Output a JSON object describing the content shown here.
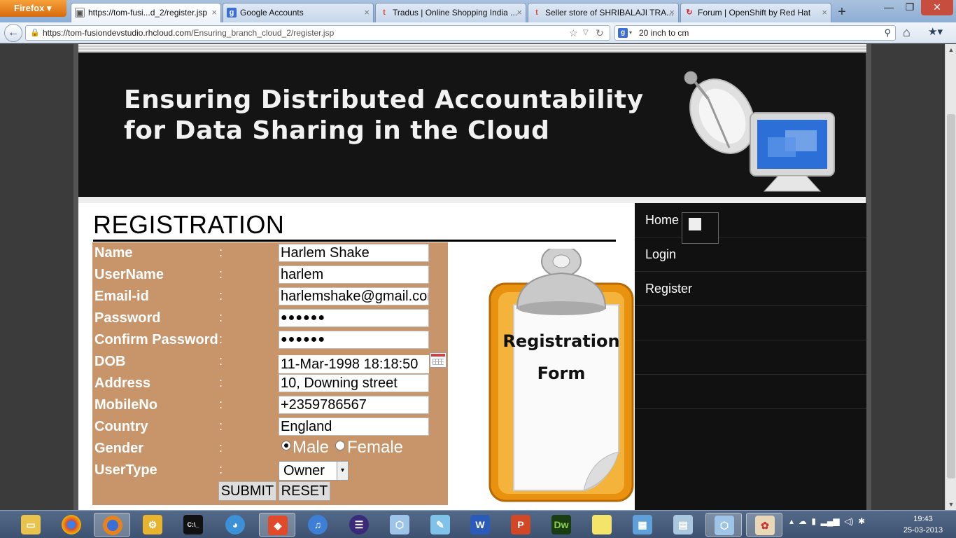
{
  "browser": {
    "menu_button": "Firefox",
    "tabs": [
      {
        "label": "https://tom-fusi...d_2/register.jsp",
        "favicon": "page"
      },
      {
        "label": "Google Accounts",
        "favicon": "g"
      },
      {
        "label": "Tradus | Online Shopping India ...",
        "favicon": "t"
      },
      {
        "label": "Seller store of SHRIBALAJI TRA...",
        "favicon": "t"
      },
      {
        "label": "Forum | OpenShift by Red Hat",
        "favicon": "openshift"
      }
    ],
    "url_host": "https://tom-fusiondevstudio.rhcloud.com",
    "url_path": "/Ensuring_branch_cloud_2/register.jsp",
    "search_text": "20 inch to cm",
    "colors": {
      "accent": "#e8821c",
      "chrome": "#a9c1de"
    }
  },
  "banner": {
    "title_line1": "Ensuring Distributed Accountability",
    "title_line2": "for Data Sharing in the Cloud"
  },
  "page": {
    "heading": "REGISTRATION",
    "form_bg_color": "#c8956b",
    "fields": [
      {
        "label": "Name",
        "colon": ":",
        "value": "Harlem Shake"
      },
      {
        "label": "UserName",
        "colon": ":",
        "value": "harlem"
      },
      {
        "label": "Email-id",
        "colon": ":",
        "value": "harlemshake@gmail.com"
      },
      {
        "label": "Password",
        "colon": ":",
        "value": "●●●●●●"
      },
      {
        "label": "Confirm Password",
        "colon": ":",
        "value": "●●●●●●"
      },
      {
        "label": "DOB",
        "colon": ":",
        "value": "11-Mar-1998 18:18:50"
      },
      {
        "label": "Address",
        "colon": ":",
        "value": "10, Downing street"
      },
      {
        "label": "MobileNo",
        "colon": ":",
        "value": "+2359786567"
      },
      {
        "label": "Country",
        "colon": ":",
        "value": "England"
      }
    ],
    "gender": {
      "label": "Gender",
      "colon": ":",
      "options": [
        "Male",
        "Female"
      ],
      "selected": "Male"
    },
    "usertype": {
      "label": "UserType",
      "colon": ":",
      "value": "Owner"
    },
    "submit_label": "SUBMIT",
    "reset_label": "RESET",
    "clipboard_line1": "Registration",
    "clipboard_line2": "Form"
  },
  "sidebar": {
    "items": [
      {
        "label": "Home"
      },
      {
        "label": "Login"
      },
      {
        "label": "Register"
      }
    ]
  },
  "taskbar": {
    "time": "19:43",
    "date": "25-03-2013",
    "apps": [
      "folder",
      "chrome",
      "firefox",
      "files",
      "cmd",
      "app",
      "git",
      "itunes",
      "eclipse",
      "cube",
      "notepad",
      "word",
      "powerpoint",
      "dreamweaver",
      "sticky",
      "control-panel",
      "monitor",
      "virtualbox",
      "paint"
    ]
  }
}
